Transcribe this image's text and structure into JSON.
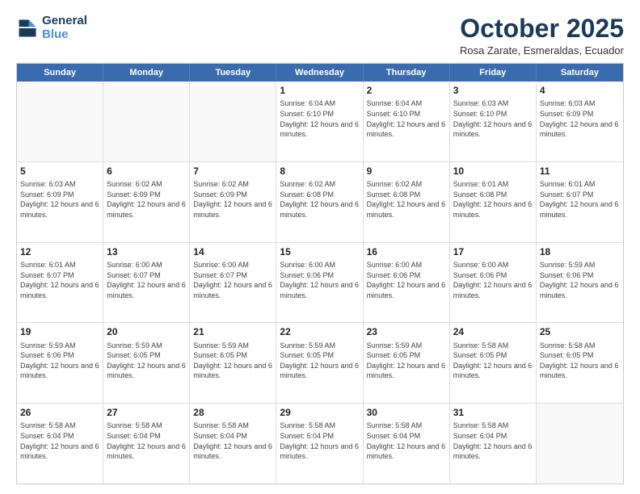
{
  "header": {
    "logo_line1": "General",
    "logo_line2": "Blue",
    "month_title": "October 2025",
    "subtitle": "Rosa Zarate, Esmeraldas, Ecuador"
  },
  "days_of_week": [
    "Sunday",
    "Monday",
    "Tuesday",
    "Wednesday",
    "Thursday",
    "Friday",
    "Saturday"
  ],
  "rows": [
    [
      {
        "day": "",
        "text": ""
      },
      {
        "day": "",
        "text": ""
      },
      {
        "day": "",
        "text": ""
      },
      {
        "day": "1",
        "text": "Sunrise: 6:04 AM\nSunset: 6:10 PM\nDaylight: 12 hours and 6 minutes."
      },
      {
        "day": "2",
        "text": "Sunrise: 6:04 AM\nSunset: 6:10 PM\nDaylight: 12 hours and 6 minutes."
      },
      {
        "day": "3",
        "text": "Sunrise: 6:03 AM\nSunset: 6:10 PM\nDaylight: 12 hours and 6 minutes."
      },
      {
        "day": "4",
        "text": "Sunrise: 6:03 AM\nSunset: 6:09 PM\nDaylight: 12 hours and 6 minutes."
      }
    ],
    [
      {
        "day": "5",
        "text": "Sunrise: 6:03 AM\nSunset: 6:09 PM\nDaylight: 12 hours and 6 minutes."
      },
      {
        "day": "6",
        "text": "Sunrise: 6:02 AM\nSunset: 6:09 PM\nDaylight: 12 hours and 6 minutes."
      },
      {
        "day": "7",
        "text": "Sunrise: 6:02 AM\nSunset: 6:09 PM\nDaylight: 12 hours and 6 minutes."
      },
      {
        "day": "8",
        "text": "Sunrise: 6:02 AM\nSunset: 6:08 PM\nDaylight: 12 hours and 6 minutes."
      },
      {
        "day": "9",
        "text": "Sunrise: 6:02 AM\nSunset: 6:08 PM\nDaylight: 12 hours and 6 minutes."
      },
      {
        "day": "10",
        "text": "Sunrise: 6:01 AM\nSunset: 6:08 PM\nDaylight: 12 hours and 6 minutes."
      },
      {
        "day": "11",
        "text": "Sunrise: 6:01 AM\nSunset: 6:07 PM\nDaylight: 12 hours and 6 minutes."
      }
    ],
    [
      {
        "day": "12",
        "text": "Sunrise: 6:01 AM\nSunset: 6:07 PM\nDaylight: 12 hours and 6 minutes."
      },
      {
        "day": "13",
        "text": "Sunrise: 6:00 AM\nSunset: 6:07 PM\nDaylight: 12 hours and 6 minutes."
      },
      {
        "day": "14",
        "text": "Sunrise: 6:00 AM\nSunset: 6:07 PM\nDaylight: 12 hours and 6 minutes."
      },
      {
        "day": "15",
        "text": "Sunrise: 6:00 AM\nSunset: 6:06 PM\nDaylight: 12 hours and 6 minutes."
      },
      {
        "day": "16",
        "text": "Sunrise: 6:00 AM\nSunset: 6:06 PM\nDaylight: 12 hours and 6 minutes."
      },
      {
        "day": "17",
        "text": "Sunrise: 6:00 AM\nSunset: 6:06 PM\nDaylight: 12 hours and 6 minutes."
      },
      {
        "day": "18",
        "text": "Sunrise: 5:59 AM\nSunset: 6:06 PM\nDaylight: 12 hours and 6 minutes."
      }
    ],
    [
      {
        "day": "19",
        "text": "Sunrise: 5:59 AM\nSunset: 6:06 PM\nDaylight: 12 hours and 6 minutes."
      },
      {
        "day": "20",
        "text": "Sunrise: 5:59 AM\nSunset: 6:05 PM\nDaylight: 12 hours and 6 minutes."
      },
      {
        "day": "21",
        "text": "Sunrise: 5:59 AM\nSunset: 6:05 PM\nDaylight: 12 hours and 6 minutes."
      },
      {
        "day": "22",
        "text": "Sunrise: 5:59 AM\nSunset: 6:05 PM\nDaylight: 12 hours and 6 minutes."
      },
      {
        "day": "23",
        "text": "Sunrise: 5:59 AM\nSunset: 6:05 PM\nDaylight: 12 hours and 6 minutes."
      },
      {
        "day": "24",
        "text": "Sunrise: 5:58 AM\nSunset: 6:05 PM\nDaylight: 12 hours and 6 minutes."
      },
      {
        "day": "25",
        "text": "Sunrise: 5:58 AM\nSunset: 6:05 PM\nDaylight: 12 hours and 6 minutes."
      }
    ],
    [
      {
        "day": "26",
        "text": "Sunrise: 5:58 AM\nSunset: 6:04 PM\nDaylight: 12 hours and 6 minutes."
      },
      {
        "day": "27",
        "text": "Sunrise: 5:58 AM\nSunset: 6:04 PM\nDaylight: 12 hours and 6 minutes."
      },
      {
        "day": "28",
        "text": "Sunrise: 5:58 AM\nSunset: 6:04 PM\nDaylight: 12 hours and 6 minutes."
      },
      {
        "day": "29",
        "text": "Sunrise: 5:58 AM\nSunset: 6:04 PM\nDaylight: 12 hours and 6 minutes."
      },
      {
        "day": "30",
        "text": "Sunrise: 5:58 AM\nSunset: 6:04 PM\nDaylight: 12 hours and 6 minutes."
      },
      {
        "day": "31",
        "text": "Sunrise: 5:58 AM\nSunset: 6:04 PM\nDaylight: 12 hours and 6 minutes."
      },
      {
        "day": "",
        "text": ""
      }
    ]
  ]
}
